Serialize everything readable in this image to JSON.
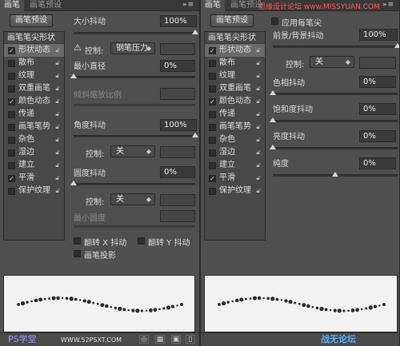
{
  "watermark_top": "思缘设计论坛 www.MISSYUAN.COM",
  "watermark_bottom_left": "PS学堂",
  "watermark_bottom_mid": "WWW.52PSXT.COM",
  "watermark_bottom_right": "战无论坛",
  "left": {
    "tabs": [
      "画笔",
      "画笔预设"
    ],
    "menu_icon": "»≡",
    "preset_button": "画笔预设",
    "list_header": "画笔笔尖形状",
    "items": [
      {
        "label": "形状动态",
        "checked": true
      },
      {
        "label": "散布",
        "checked": false
      },
      {
        "label": "纹理",
        "checked": false
      },
      {
        "label": "双重画笔",
        "checked": false
      },
      {
        "label": "颜色动态",
        "checked": true
      },
      {
        "label": "传递",
        "checked": false
      },
      {
        "label": "画笔笔势",
        "checked": false
      },
      {
        "label": "杂色",
        "checked": false
      },
      {
        "label": "湿边",
        "checked": false
      },
      {
        "label": "建立",
        "checked": false
      },
      {
        "label": "平滑",
        "checked": true
      },
      {
        "label": "保护纹理",
        "checked": false
      }
    ],
    "size_jitter_label": "大小抖动",
    "size_jitter_value": "100%",
    "size_jitter_fraction": 1.0,
    "control_label": "控制:",
    "control_value_1": "钢笔压力",
    "min_diameter_label": "最小直径",
    "min_diameter_value": "0%",
    "tilt_scale_label": "倾斜缩放比例",
    "angle_jitter_label": "角度抖动",
    "angle_jitter_value": "100%",
    "angle_jitter_fraction": 1.0,
    "control_label_2": "控制:",
    "control_value_2": "关",
    "roundness_jitter_label": "圆度抖动",
    "roundness_jitter_value": "0%",
    "control_label_3": "控制:",
    "control_value_3": "关",
    "min_roundness_label": "最小圆度",
    "flip_x": "翻转 X 抖动",
    "flip_y": "翻转 Y 抖动",
    "brush_projection": "画笔投影"
  },
  "right": {
    "tabs": [
      "画笔",
      "画笔预设"
    ],
    "menu_icon": "»≡",
    "preset_button": "画笔预设",
    "list_header": "画笔笔尖形状",
    "items": [
      {
        "label": "形状动态",
        "checked": true
      },
      {
        "label": "散布",
        "checked": false
      },
      {
        "label": "纹理",
        "checked": false
      },
      {
        "label": "双重画笔",
        "checked": false
      },
      {
        "label": "颜色动态",
        "checked": true
      },
      {
        "label": "传递",
        "checked": false
      },
      {
        "label": "画笔笔势",
        "checked": false
      },
      {
        "label": "杂色",
        "checked": false
      },
      {
        "label": "湿边",
        "checked": false
      },
      {
        "label": "建立",
        "checked": false
      },
      {
        "label": "平滑",
        "checked": true
      },
      {
        "label": "保护纹理",
        "checked": false
      }
    ],
    "apply_per_tip": "应用每笔尖",
    "fg_bg_jitter_label": "前景/背景抖动",
    "fg_bg_jitter_value": "100%",
    "control_label": "控制:",
    "control_value": "关",
    "hue_jitter_label": "色相抖动",
    "hue_jitter_value": "0%",
    "saturation_jitter_label": "饱和度抖动",
    "saturation_jitter_value": "0%",
    "brightness_jitter_label": "亮度抖动",
    "brightness_jitter_value": "0%",
    "purity_label": "纯度",
    "purity_value": "0%",
    "purity_fraction": 0.5
  }
}
